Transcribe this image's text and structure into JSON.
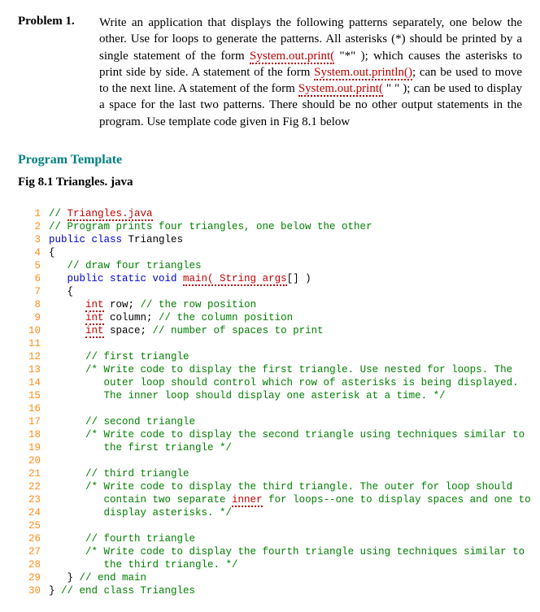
{
  "problem": {
    "label": "Problem 1.",
    "body_parts": [
      "Write an application that displays the following patterns separately, one below the other. Use for loops to generate the patterns. All asterisks (*) should be printed by a single statement of the form ",
      "System.out.print(",
      " \"*\" ); which causes the asterisks to print side by side. A statement of the form ",
      "System.out.println()",
      "; can be used to move to the next line. A statement of the form ",
      "System.out.print(",
      " \" \" ); can be used to display a space for the last two patterns. There should be no other output statements in the program. Use template code given in Fig 8.1 below"
    ]
  },
  "section_title": "Program Template",
  "fig_title": "Fig 8.1 Triangles. java",
  "code": [
    {
      "n": 1,
      "frags": [
        {
          "t": "// ",
          "c": "c-comment"
        },
        {
          "t": "Triangles.java",
          "c": "c-err"
        }
      ]
    },
    {
      "n": 2,
      "frags": [
        {
          "t": "// Program prints four triangles, one below the other",
          "c": "c-comment"
        }
      ]
    },
    {
      "n": 3,
      "frags": [
        {
          "t": "public class ",
          "c": "c-key"
        },
        {
          "t": "Triangles",
          "c": "c-plain"
        }
      ]
    },
    {
      "n": 4,
      "frags": [
        {
          "t": "{",
          "c": "c-plain"
        }
      ]
    },
    {
      "n": "",
      "frags": [
        {
          "t": "",
          "c": "c-plain"
        }
      ]
    },
    {
      "n": 5,
      "frags": [
        {
          "t": "   ",
          "c": ""
        },
        {
          "t": "// draw four triangles",
          "c": "c-comment"
        }
      ]
    },
    {
      "n": 6,
      "frags": [
        {
          "t": "   ",
          "c": ""
        },
        {
          "t": "public static void ",
          "c": "c-key"
        },
        {
          "t": "main( String args",
          "c": "c-err"
        },
        {
          "t": "[] )",
          "c": "c-plain"
        }
      ]
    },
    {
      "n": 7,
      "frags": [
        {
          "t": "   {",
          "c": "c-plain"
        }
      ]
    },
    {
      "n": 8,
      "frags": [
        {
          "t": "      ",
          "c": ""
        },
        {
          "t": "int",
          "c": "c-type"
        },
        {
          "t": " row; ",
          "c": "c-plain"
        },
        {
          "t": "// the row position",
          "c": "c-comment"
        }
      ]
    },
    {
      "n": 9,
      "frags": [
        {
          "t": "      ",
          "c": ""
        },
        {
          "t": "int",
          "c": "c-type"
        },
        {
          "t": " column; ",
          "c": "c-plain"
        },
        {
          "t": "// the column position",
          "c": "c-comment"
        }
      ]
    },
    {
      "n": 10,
      "frags": [
        {
          "t": "      ",
          "c": ""
        },
        {
          "t": "int",
          "c": "c-type"
        },
        {
          "t": " space; ",
          "c": "c-plain"
        },
        {
          "t": "// number of spaces to print",
          "c": "c-comment"
        }
      ]
    },
    {
      "n": 11,
      "frags": [
        {
          "t": "",
          "c": ""
        }
      ]
    },
    {
      "n": 12,
      "frags": [
        {
          "t": "      ",
          "c": ""
        },
        {
          "t": "// first triangle",
          "c": "c-comment"
        }
      ]
    },
    {
      "n": 13,
      "frags": [
        {
          "t": "      ",
          "c": ""
        },
        {
          "t": "/* Write code to display the first triangle. Use nested for loops. The",
          "c": "c-comment"
        }
      ]
    },
    {
      "n": 14,
      "frags": [
        {
          "t": "         outer loop should control which row of asterisks is being displayed.",
          "c": "c-comment"
        }
      ]
    },
    {
      "n": 15,
      "frags": [
        {
          "t": "         The inner loop should display one asterisk at a time. */",
          "c": "c-comment"
        }
      ]
    },
    {
      "n": 16,
      "frags": [
        {
          "t": "",
          "c": ""
        }
      ]
    },
    {
      "n": 17,
      "frags": [
        {
          "t": "      ",
          "c": ""
        },
        {
          "t": "// second triangle",
          "c": "c-comment"
        }
      ]
    },
    {
      "n": 18,
      "frags": [
        {
          "t": "      ",
          "c": ""
        },
        {
          "t": "/* Write code to display the second triangle using techniques similar to",
          "c": "c-comment"
        }
      ]
    },
    {
      "n": 19,
      "frags": [
        {
          "t": "         the first triangle */",
          "c": "c-comment"
        }
      ]
    },
    {
      "n": 20,
      "frags": [
        {
          "t": "",
          "c": ""
        }
      ]
    },
    {
      "n": 21,
      "frags": [
        {
          "t": "      ",
          "c": ""
        },
        {
          "t": "// third triangle",
          "c": "c-comment"
        }
      ]
    },
    {
      "n": 22,
      "frags": [
        {
          "t": "      ",
          "c": ""
        },
        {
          "t": "/* Write code to display the third triangle. The outer for loop should",
          "c": "c-comment"
        }
      ]
    },
    {
      "n": 23,
      "frags": [
        {
          "t": "         contain two separate ",
          "c": "c-comment"
        },
        {
          "t": "inner",
          "c": "c-err"
        },
        {
          "t": " for loops--one to display spaces and one to",
          "c": "c-comment"
        }
      ]
    },
    {
      "n": 24,
      "frags": [
        {
          "t": "         display asterisks. */",
          "c": "c-comment"
        }
      ]
    },
    {
      "n": 25,
      "frags": [
        {
          "t": "",
          "c": ""
        }
      ]
    },
    {
      "n": 26,
      "frags": [
        {
          "t": "      ",
          "c": ""
        },
        {
          "t": "// fourth triangle",
          "c": "c-comment"
        }
      ]
    },
    {
      "n": 27,
      "frags": [
        {
          "t": "      ",
          "c": ""
        },
        {
          "t": "/* Write code to display the fourth triangle using techniques similar to",
          "c": "c-comment"
        }
      ]
    },
    {
      "n": 28,
      "frags": [
        {
          "t": "         the third triangle. */",
          "c": "c-comment"
        }
      ]
    },
    {
      "n": 29,
      "frags": [
        {
          "t": "   } ",
          "c": "c-plain"
        },
        {
          "t": "// end main",
          "c": "c-comment"
        }
      ]
    },
    {
      "n": 30,
      "frags": [
        {
          "t": "} ",
          "c": "c-plain"
        },
        {
          "t": "// end class Triangles",
          "c": "c-comment"
        }
      ]
    }
  ]
}
